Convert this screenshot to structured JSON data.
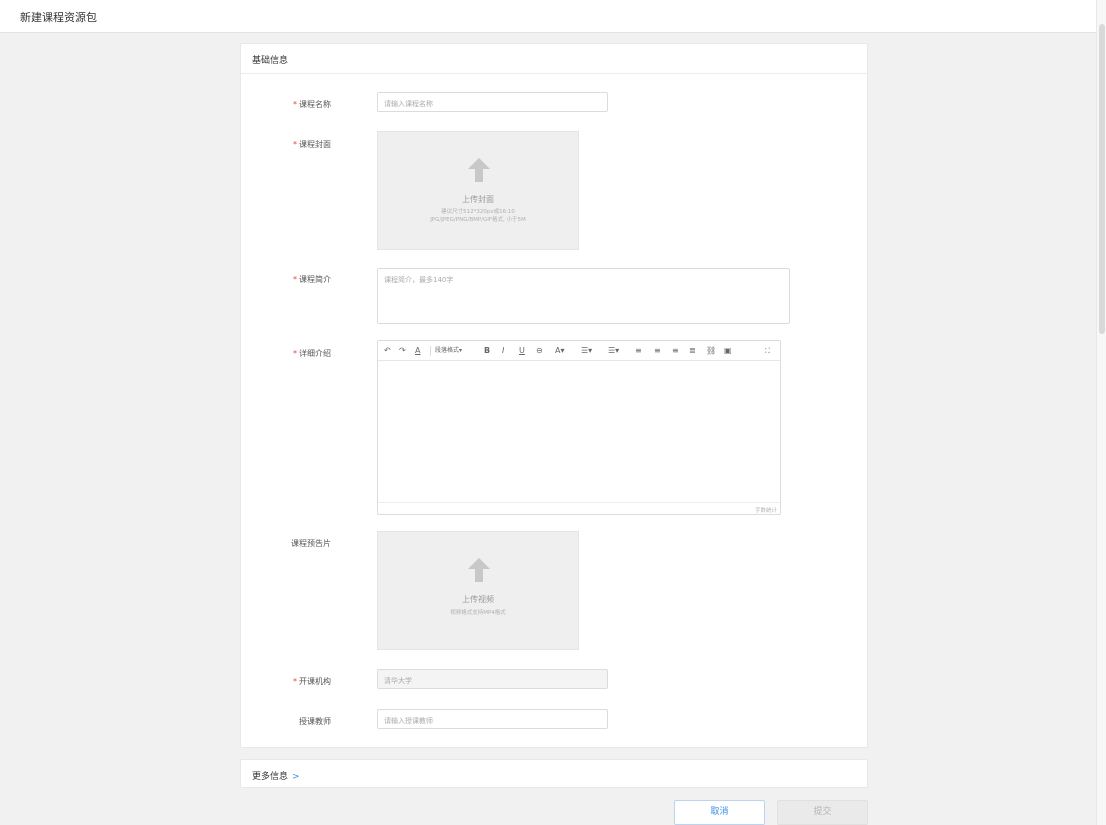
{
  "page": {
    "title": "新建课程资源包"
  },
  "basic": {
    "header": "基础信息",
    "course_name": {
      "label": "课程名称",
      "placeholder": "请输入课程名称"
    },
    "cover": {
      "label": "课程封面",
      "upload_title": "上传封面",
      "hint1": "建议尺寸512*320px或16:10",
      "hint2": "JPG/JPEG/PNG/BMP/GIF格式, 小于5M"
    },
    "intro": {
      "label": "课程简介",
      "placeholder": "课程简介，最多140字"
    },
    "detail": {
      "label": "详细介绍",
      "toolbar_paragraph": "段落格式",
      "word_count": "字数统计"
    },
    "preview": {
      "label": "课程预告片",
      "upload_title": "上传视频",
      "hint": "视频格式支持MP4格式"
    },
    "org": {
      "label": "开课机构",
      "value": "清华大学"
    },
    "teacher": {
      "label": "授课教师",
      "placeholder": "请输入授课教师"
    }
  },
  "more": {
    "label": "更多信息",
    "chevron": ">"
  },
  "actions": {
    "cancel": "取消",
    "submit": "提交"
  },
  "required_mark": "*",
  "toolbar_icons": [
    "undo-icon",
    "redo-icon",
    "clear-format-icon",
    "bold-icon",
    "italic-icon",
    "underline-icon",
    "strikethrough-icon",
    "font-color-icon",
    "ordered-list-icon",
    "unordered-list-icon",
    "align-left-icon",
    "align-center-icon",
    "align-right-icon",
    "justify-icon",
    "link-icon",
    "image-icon",
    "fullscreen-icon"
  ],
  "colors": {
    "required": "#f2403d",
    "accent": "#3a8ee6"
  }
}
